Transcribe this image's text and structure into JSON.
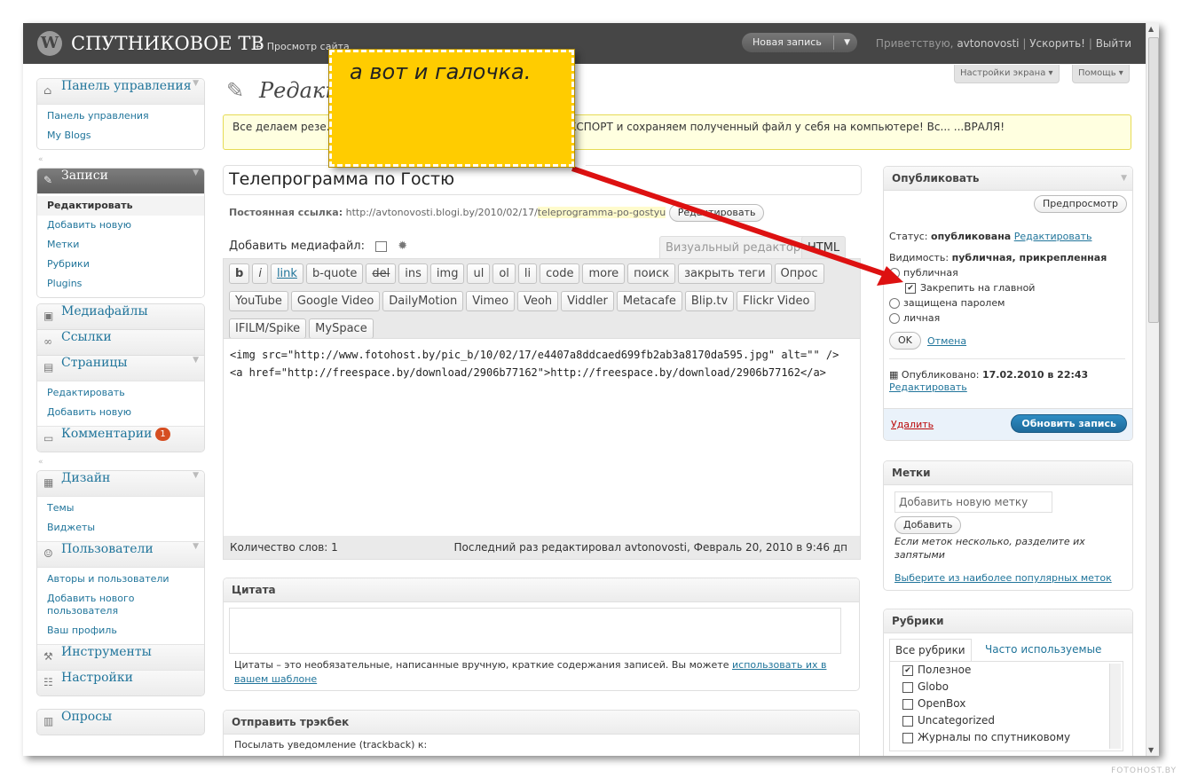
{
  "header": {
    "site_name": "СПУТНИКОВОЕ ТВ",
    "view_site": "← Просмотр сайта",
    "new_post": "Новая запись",
    "greeting": "Приветствую,",
    "username": "avtonovosti",
    "speed_up": "Ускорить!",
    "logout": "Выйти",
    "separator": "|"
  },
  "screen_tabs": {
    "screen_options": "Настройки экрана ▾",
    "help": "Помощь ▾"
  },
  "menu": {
    "dashboard": {
      "label": "Панель управления",
      "items": [
        "Панель управления",
        "My Blogs"
      ]
    },
    "posts": {
      "label": "Записи",
      "items": [
        "Редактировать",
        "Добавить новую",
        "Метки",
        "Рубрики",
        "Plugins"
      ]
    },
    "media": "Медиафайлы",
    "links": "Ссылки",
    "pages": {
      "label": "Страницы",
      "items": [
        "Редактировать",
        "Добавить новую"
      ]
    },
    "comments": {
      "label": "Комментарии",
      "count": "1"
    },
    "design": {
      "label": "Дизайн",
      "items": [
        "Темы",
        "Виджеты"
      ]
    },
    "users": {
      "label": "Пользователи",
      "items": [
        "Авторы и пользователи",
        "Добавить нового пользователя",
        "Ваш профиль"
      ]
    },
    "tools": "Инструменты",
    "settings": "Настройки",
    "polls": "Опросы"
  },
  "page": {
    "title": "Редакт",
    "notice": "Все делаем резе... ...ева в разделе ИНСТРУМЕНТЫ кнопка ЭКСПОРТ и сохраняем полученный файл у себя на компьютере! Вс... ...ВРАЛЯ!"
  },
  "post": {
    "title": "Телепрограмма по Гостю",
    "permalink_label": "Постоянная ссылка:",
    "permalink_base": "http://avtonovosti.blogi.by/2010/02/17/",
    "permalink_slug": "teleprogramma-po-gostyu",
    "edit_permalink": "Редактировать",
    "add_media": "Добавить медиафайл:",
    "visual_tab": "Визуальный редактор",
    "html_tab": "HTML",
    "quicktags_row1": [
      "b",
      "i",
      "link",
      "b-quote",
      "del",
      "ins",
      "img",
      "ul",
      "ol",
      "li",
      "code",
      "more",
      "поиск",
      "закрыть теги",
      "Опрос"
    ],
    "quicktags_row2": [
      "YouTube",
      "Google Video",
      "DailyMotion",
      "Vimeo",
      "Veoh",
      "Viddler",
      "Metacafe",
      "Blip.tv",
      "Flickr Video"
    ],
    "quicktags_row3": [
      "IFILM/Spike",
      "MySpace"
    ],
    "content_line1": "<img src=\"http://www.fotohost.by/pic_b/10/02/17/e4407a8ddcaed699fb2ab3a8170da595.jpg\" alt=\"\" />",
    "content_line2": "<a href=\"http://freespace.by/download/2906b77162\">http://freespace.by/download/2906b77162</a>",
    "word_count": "Количество слов: 1",
    "last_edited": "Последний раз редактировал avtonovosti, Февраль 20, 2010 в 9:46 дп"
  },
  "excerpt": {
    "title": "Цитата",
    "help": "Цитаты – это необязательные, написанные вручную, краткие содержания записей. Вы можете",
    "help_link": "использовать их в вашем шаблоне"
  },
  "trackback": {
    "title": "Отправить трэкбек",
    "label": "Посылать уведомление (trackback) к:"
  },
  "publish": {
    "title": "Опубликовать",
    "preview": "Предпросмотр",
    "status_label": "Статус:",
    "status_value": "опубликована",
    "edit": "Редактировать",
    "visibility_label": "Видимость:",
    "visibility_value": "публичная, прикрепленная",
    "opt_public": "публичная",
    "opt_sticky": "Закрепить на главной",
    "opt_password": "защищена паролем",
    "opt_private": "личная",
    "ok": "OK",
    "cancel": "Отмена",
    "published_label": "Опубликовано:",
    "published_value": "17.02.2010 в 22:43",
    "delete": "Удалить",
    "update": "Обновить запись"
  },
  "tags": {
    "title": "Метки",
    "placeholder": "Добавить новую  метку",
    "add": "Добавить",
    "help": "Если меток несколько, разделите их запятыми",
    "popular": "Выберите из наиболее популярных меток"
  },
  "categories": {
    "title": "Рубрики",
    "tab_all": "Все рубрики",
    "tab_popular": "Часто используемые",
    "items": [
      "Полезное",
      "Globo",
      "OpenBox",
      "Uncategorized",
      "Журналы по спутниковому"
    ]
  },
  "callout": {
    "text": "а вот и галочка."
  },
  "watermark": "FOTOHOST.BY",
  "colors": {
    "accent": "#21759b",
    "header": "#464646",
    "callout": "#ffcc00",
    "arrow": "#dd1111",
    "update_button": "#1e6a9a"
  }
}
